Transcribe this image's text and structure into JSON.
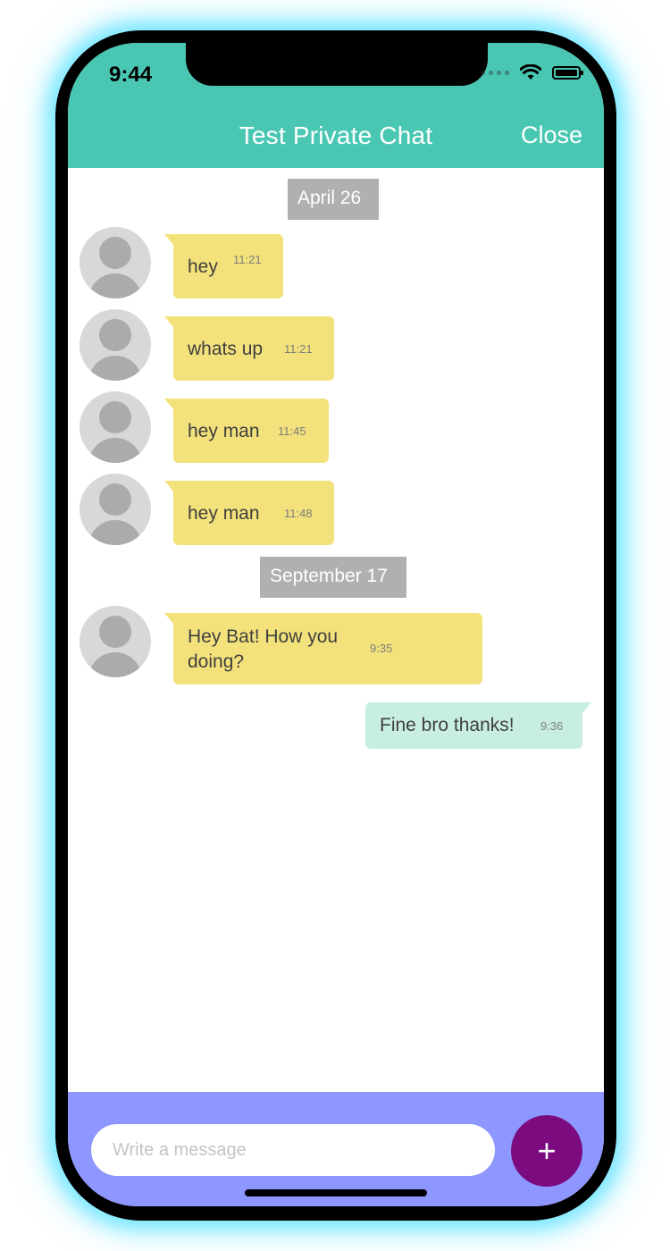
{
  "status_bar": {
    "time": "9:44"
  },
  "header": {
    "title": "Test Private Chat",
    "close_label": "Close"
  },
  "messages": {
    "date1": "April 26",
    "m1": {
      "text": "hey",
      "time": "11:21"
    },
    "m2": {
      "text": "whats up",
      "time": "11:21"
    },
    "m3": {
      "text": "hey man",
      "time": "11:45"
    },
    "m4": {
      "text": "hey man",
      "time": "11:48"
    },
    "date2": "September 17",
    "m5": {
      "text_line1": "Hey Bat! How you",
      "text_line2": "doing?",
      "time": "9:35"
    },
    "m6": {
      "text": "Fine bro thanks!",
      "time": "9:36"
    }
  },
  "composer": {
    "placeholder": "Write a message",
    "value": "",
    "send_icon": "+"
  },
  "colors": {
    "header": "#4ac7b3",
    "incoming_bubble": "#f3e27b",
    "outgoing_bubble": "#c8eee4",
    "input_bar": "#8d97ff",
    "plus_button": "#7b0b7e",
    "date_separator": "#b0b0b0"
  },
  "icons": [
    "wifi-icon",
    "battery-icon",
    "avatar-icon",
    "plus-icon"
  ]
}
